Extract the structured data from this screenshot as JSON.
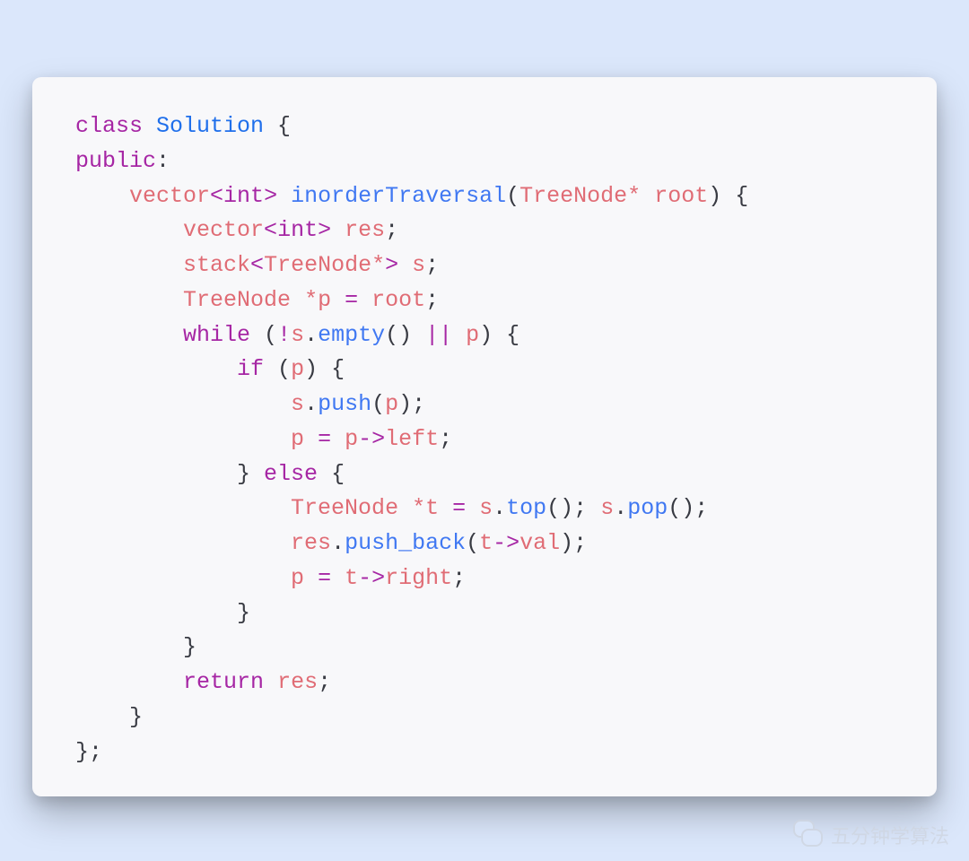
{
  "code": {
    "language": "cpp",
    "raw": "class Solution {\npublic:\n    vector<int> inorderTraversal(TreeNode* root) {\n        vector<int> res;\n        stack<TreeNode*> s;\n        TreeNode *p = root;\n        while (!s.empty() || p) {\n            if (p) {\n                s.push(p);\n                p = p->left;\n            } else {\n                TreeNode *t = s.top(); s.pop();\n                res.push_back(t->val);\n                p = t->right;\n            }\n        }\n        return res;\n    }\n};",
    "tokens": [
      [
        [
          "class ",
          "kw"
        ],
        [
          "Solution",
          "type"
        ],
        [
          " {",
          "punc"
        ]
      ],
      [
        [
          "public",
          "kw"
        ],
        [
          ":",
          "punc"
        ]
      ],
      [
        [
          "    ",
          ""
        ],
        [
          "vector",
          "id"
        ],
        [
          "<",
          "kw"
        ],
        [
          "int",
          "kw"
        ],
        [
          "> ",
          "kw"
        ],
        [
          "inorderTraversal",
          "fn"
        ],
        [
          "(",
          "punc"
        ],
        [
          "TreeNode",
          "id"
        ],
        [
          "* ",
          "id"
        ],
        [
          "root",
          "id"
        ],
        [
          ") {",
          "punc"
        ]
      ],
      [
        [
          "        ",
          ""
        ],
        [
          "vector",
          "id"
        ],
        [
          "<",
          "kw"
        ],
        [
          "int",
          "kw"
        ],
        [
          "> ",
          "kw"
        ],
        [
          "res",
          "id"
        ],
        [
          ";",
          "punc"
        ]
      ],
      [
        [
          "        ",
          ""
        ],
        [
          "stack",
          "id"
        ],
        [
          "<",
          "kw"
        ],
        [
          "TreeNode",
          "id"
        ],
        [
          "*",
          "id"
        ],
        [
          "> ",
          "kw"
        ],
        [
          "s",
          "id"
        ],
        [
          ";",
          "punc"
        ]
      ],
      [
        [
          "        ",
          ""
        ],
        [
          "TreeNode ",
          "id"
        ],
        [
          "*",
          "id"
        ],
        [
          "p ",
          "id"
        ],
        [
          "= ",
          "kw"
        ],
        [
          "root",
          "id"
        ],
        [
          ";",
          "punc"
        ]
      ],
      [
        [
          "        ",
          ""
        ],
        [
          "while ",
          "kw"
        ],
        [
          "(",
          "punc"
        ],
        [
          "!",
          "kw"
        ],
        [
          "s",
          "id"
        ],
        [
          ".",
          "punc"
        ],
        [
          "empty",
          "fn"
        ],
        [
          "() ",
          "punc"
        ],
        [
          "|| ",
          "kw"
        ],
        [
          "p",
          "id"
        ],
        [
          ") {",
          "punc"
        ]
      ],
      [
        [
          "            ",
          ""
        ],
        [
          "if ",
          "kw"
        ],
        [
          "(",
          "punc"
        ],
        [
          "p",
          "id"
        ],
        [
          ") {",
          "punc"
        ]
      ],
      [
        [
          "                ",
          ""
        ],
        [
          "s",
          "id"
        ],
        [
          ".",
          "punc"
        ],
        [
          "push",
          "fn"
        ],
        [
          "(",
          "punc"
        ],
        [
          "p",
          "id"
        ],
        [
          ");",
          "punc"
        ]
      ],
      [
        [
          "                ",
          ""
        ],
        [
          "p ",
          "id"
        ],
        [
          "= ",
          "kw"
        ],
        [
          "p",
          "id"
        ],
        [
          "->",
          "kw"
        ],
        [
          "left",
          "id"
        ],
        [
          ";",
          "punc"
        ]
      ],
      [
        [
          "            } ",
          "punc"
        ],
        [
          "else ",
          "kw"
        ],
        [
          "{",
          "punc"
        ]
      ],
      [
        [
          "                ",
          ""
        ],
        [
          "TreeNode ",
          "id"
        ],
        [
          "*",
          "id"
        ],
        [
          "t ",
          "id"
        ],
        [
          "= ",
          "kw"
        ],
        [
          "s",
          "id"
        ],
        [
          ".",
          "punc"
        ],
        [
          "top",
          "fn"
        ],
        [
          "(); ",
          "punc"
        ],
        [
          "s",
          "id"
        ],
        [
          ".",
          "punc"
        ],
        [
          "pop",
          "fn"
        ],
        [
          "();",
          "punc"
        ]
      ],
      [
        [
          "                ",
          ""
        ],
        [
          "res",
          "id"
        ],
        [
          ".",
          "punc"
        ],
        [
          "push_back",
          "fn"
        ],
        [
          "(",
          "punc"
        ],
        [
          "t",
          "id"
        ],
        [
          "->",
          "kw"
        ],
        [
          "val",
          "id"
        ],
        [
          ");",
          "punc"
        ]
      ],
      [
        [
          "                ",
          ""
        ],
        [
          "p ",
          "id"
        ],
        [
          "= ",
          "kw"
        ],
        [
          "t",
          "id"
        ],
        [
          "->",
          "kw"
        ],
        [
          "right",
          "id"
        ],
        [
          ";",
          "punc"
        ]
      ],
      [
        [
          "            }",
          "punc"
        ]
      ],
      [
        [
          "        }",
          "punc"
        ]
      ],
      [
        [
          "        ",
          ""
        ],
        [
          "return ",
          "kw"
        ],
        [
          "res",
          "id"
        ],
        [
          ";",
          "punc"
        ]
      ],
      [
        [
          "    }",
          "punc"
        ]
      ],
      [
        [
          "};",
          "punc"
        ]
      ]
    ]
  },
  "watermark": {
    "text": "五分钟学算法",
    "icon": "wechat-icon"
  },
  "colors": {
    "background": "#dbe7fb",
    "card": "#f8f8fa",
    "keyword": "#a626a4",
    "type": "#1f6feb",
    "identifier": "#e06c75",
    "function": "#4078f2",
    "punctuation": "#383a42"
  }
}
